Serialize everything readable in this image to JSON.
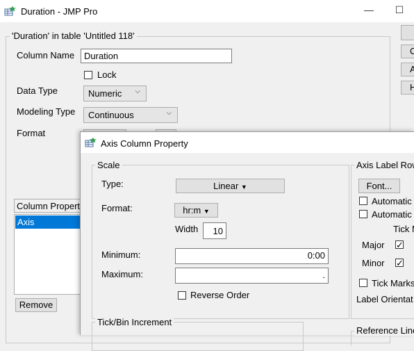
{
  "window": {
    "title": "Duration - JMP Pro",
    "minimize": "—",
    "maximize": "☐"
  },
  "column_panel": {
    "group_title": "'Duration' in table 'Untitled 118'",
    "column_name_label": "Column Name",
    "column_name_value": "Duration",
    "lock_label": "Lock",
    "data_type_label": "Data Type",
    "data_type_value": "Numeric",
    "modeling_type_label": "Modeling Type",
    "modeling_type_value": "Continuous",
    "format_label": "Format",
    "column_properties_header": "Column Propert",
    "column_properties_items": [
      "Axis"
    ],
    "remove_button": "Remove",
    "right_buttons": [
      "",
      "C",
      "A",
      "H"
    ]
  },
  "dialog": {
    "title": "Axis Column Property",
    "scale": {
      "group_title": "Scale",
      "type_label": "Type:",
      "type_value": "Linear",
      "format_label": "Format:",
      "format_value": "hr:m",
      "width_label": "Width",
      "width_value": "10",
      "minimum_label": "Minimum:",
      "minimum_value": "0:00",
      "maximum_label": "Maximum:",
      "maximum_value": ".",
      "reverse_order_label": "Reverse Order"
    },
    "tick_bin": {
      "group_title": "Tick/Bin Increment"
    },
    "axis_label_row": {
      "group_title": "Axis Label Row",
      "font_button": "Font...",
      "automatic_1": "Automatic I",
      "automatic_2": "Automatic T",
      "tick_header": "Tick M",
      "major_label": "Major",
      "minor_label": "Minor",
      "tick_marks_label": "Tick Marks I",
      "label_orientation": "Label Orientat"
    },
    "reference_lines": {
      "group_title": "Reference Line"
    }
  },
  "colors": {
    "selection": "#0078d7",
    "dialog_bg": "#f0f0f0",
    "icon_green": "#2e9d4f"
  }
}
